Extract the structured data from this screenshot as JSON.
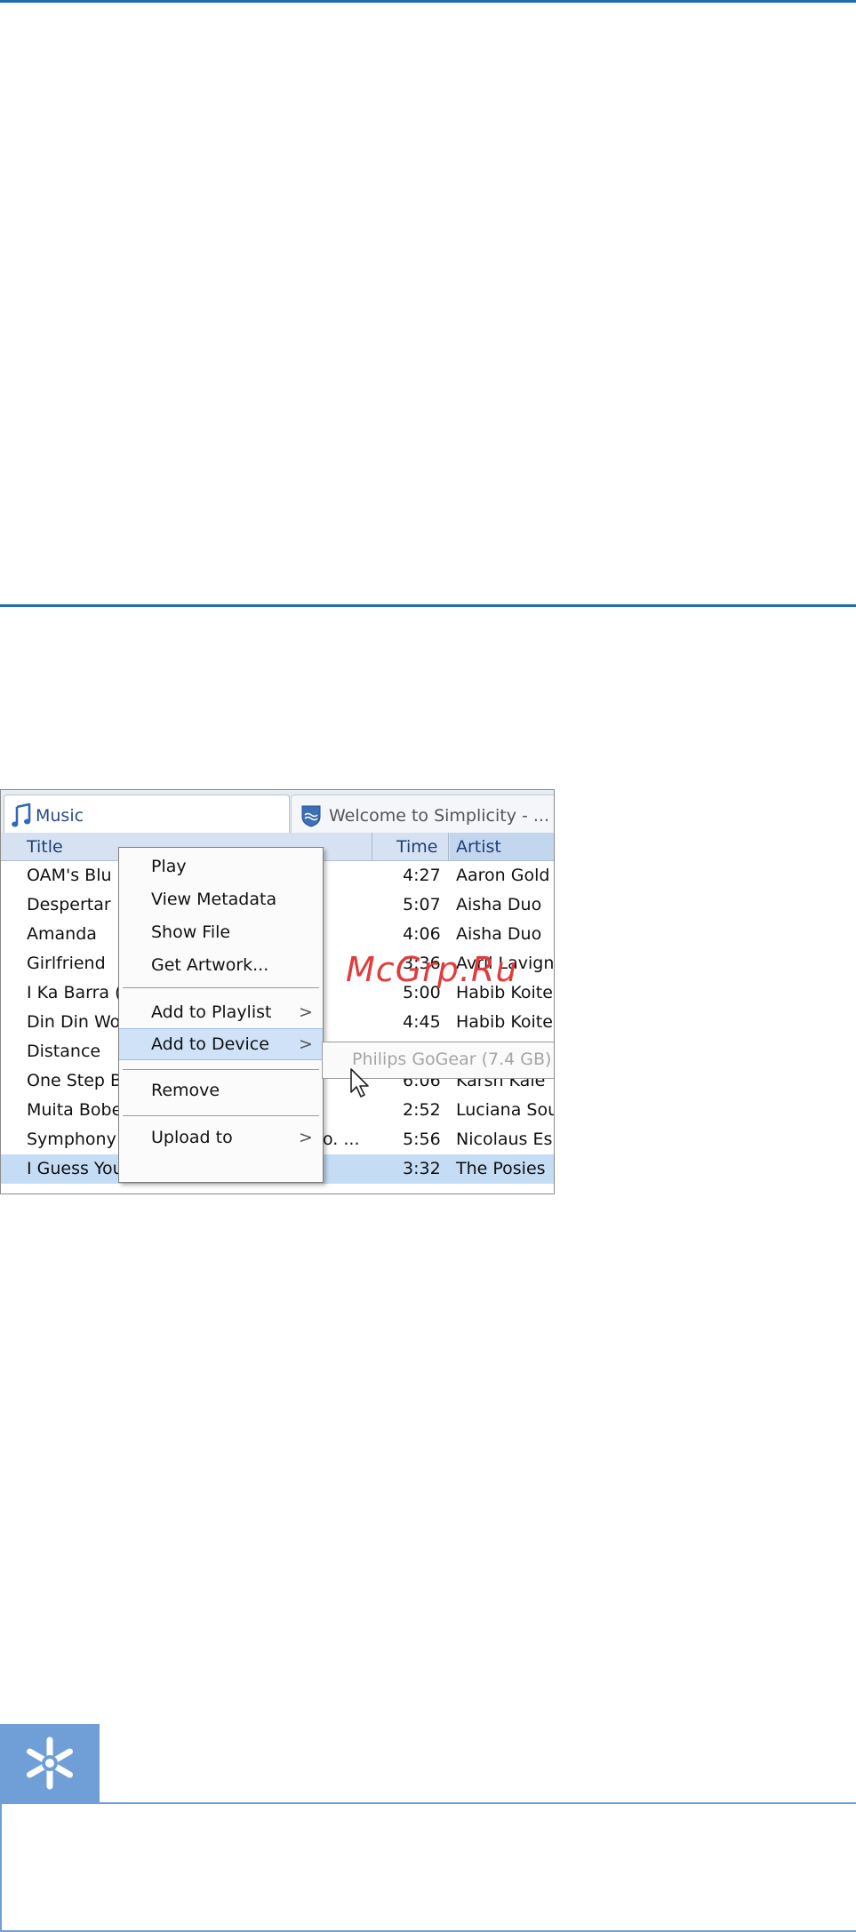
{
  "tabs": [
    {
      "label": "Music",
      "icon": "music-note-icon"
    },
    {
      "label": "Welcome to Simplicity - ...",
      "icon": "philips-shield-icon"
    }
  ],
  "columns": {
    "title": "Title",
    "time": "Time",
    "artist": "Artist"
  },
  "rows": [
    {
      "title": "OAM's Blu",
      "time": "4:27",
      "artist": "Aaron Gold"
    },
    {
      "title": "Despertar",
      "time": "5:07",
      "artist": "Aisha Duo"
    },
    {
      "title": "Amanda",
      "time": "4:06",
      "artist": "Aisha Duo"
    },
    {
      "title": "Girlfriend",
      "time": "3:36",
      "artist": "Avril Lavign"
    },
    {
      "title": "I Ka Barra (",
      "time": "5:00",
      "artist": "Habib Koite"
    },
    {
      "title": "Din Din Wo",
      "time": "4:45",
      "artist": "Habib Koite"
    },
    {
      "title": "Distance",
      "time": "",
      "artist": ""
    },
    {
      "title": "One Step B",
      "time": "6:06",
      "artist": "Karsh Kale"
    },
    {
      "title": "Muita Bobe",
      "time": "2:52",
      "artist": "Luciana Sou"
    },
    {
      "title": "Symphony",
      "extra": "o. ...",
      "time": "5:56",
      "artist": "Nicolaus Es"
    },
    {
      "title": "I Guess You're Right",
      "time": "3:32",
      "artist": "The Posies",
      "selected": true
    }
  ],
  "context_menu": {
    "items": [
      "Play",
      "View Metadata",
      "Show File",
      "Get Artwork...",
      "Add to Playlist",
      "Add to Device",
      "Remove",
      "Upload to"
    ],
    "arrow": ">",
    "highlighted": "Add to Device"
  },
  "submenu": {
    "device": "Philips GoGear (7.4 GB)"
  },
  "watermark": "McGrp.Ru",
  "tip_icon": "asterisk-icon",
  "colors": {
    "rule": "#1f6bb5",
    "tip": "#6f9fd6",
    "selection": "#c4dcf4",
    "watermark": "#e23b3b"
  }
}
